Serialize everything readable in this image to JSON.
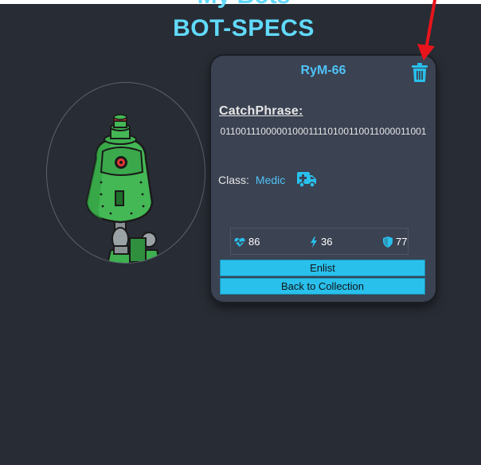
{
  "page": {
    "top_cut_title": "My Bots",
    "title": "BOT-SPECS"
  },
  "bot": {
    "name": "RyM-66",
    "catchphrase_label": "CatchPhrase:",
    "catchphrase": "0110011100000100011110100110011000011001",
    "class_label": "Class:",
    "class_value": "Medic",
    "class_icon": "ambulance-icon",
    "stats": {
      "health": "86",
      "damage": "36",
      "armor": "77"
    }
  },
  "actions": {
    "delete_icon": "trash-icon",
    "enlist_label": "Enlist",
    "back_label": "Back to Collection"
  },
  "colors": {
    "background": "#282c34",
    "accent": "#4fc3f7",
    "card": "#3b4252",
    "button": "#29c0ec",
    "annotation_arrow": "#e8141c"
  }
}
